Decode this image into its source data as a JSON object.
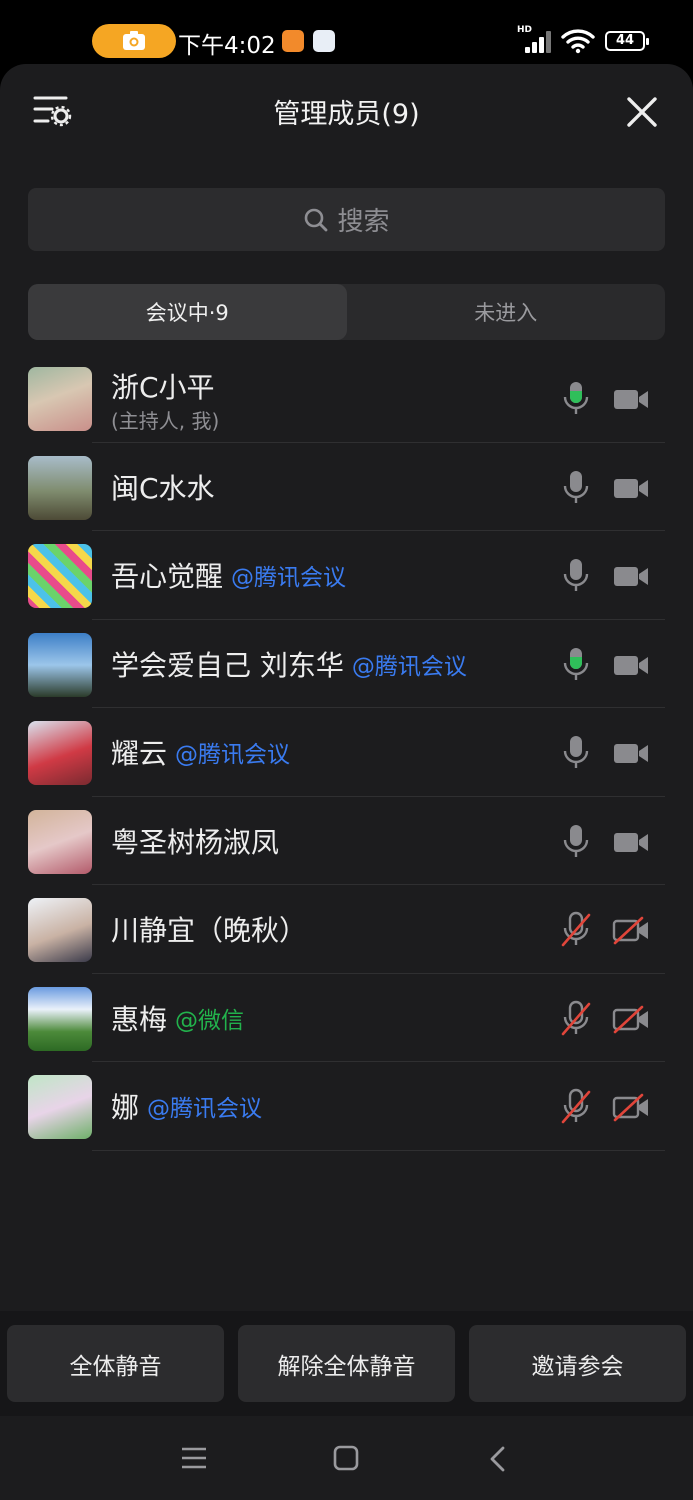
{
  "status_bar": {
    "time": "下午4:02",
    "battery": "44",
    "network": "HD"
  },
  "header": {
    "title": "管理成员(9)"
  },
  "search": {
    "placeholder": "搜索"
  },
  "tabs": [
    {
      "label": "会议中·9"
    },
    {
      "label": "未进入"
    }
  ],
  "participants": [
    {
      "name": "浙C小平",
      "subtitle": "(主持人, 我)",
      "tag": "",
      "mic": "active",
      "camera": "off"
    },
    {
      "name": "闽C水水",
      "subtitle": "",
      "tag": "",
      "mic": "idle",
      "camera": "idle"
    },
    {
      "name": "吾心觉醒",
      "subtitle": "",
      "tag": "@腾讯会议",
      "mic": "idle",
      "camera": "idle"
    },
    {
      "name": "学会爱自己 刘东华",
      "subtitle": "",
      "tag": "@腾讯会议",
      "mic": "active",
      "camera": "idle"
    },
    {
      "name": "耀云",
      "subtitle": "",
      "tag": "@腾讯会议",
      "mic": "idle",
      "camera": "idle"
    },
    {
      "name": "粤圣树杨淑凤",
      "subtitle": "",
      "tag": "",
      "mic": "idle",
      "camera": "idle"
    },
    {
      "name": "川静宜（晚秋）",
      "subtitle": "",
      "tag": "",
      "mic": "muted",
      "camera": "muted"
    },
    {
      "name": "惠梅",
      "subtitle": "",
      "tag": "@微信",
      "mic": "muted",
      "camera": "muted"
    },
    {
      "name": "娜",
      "subtitle": "",
      "tag": "@腾讯会议",
      "mic": "muted",
      "camera": "muted"
    }
  ],
  "actions": {
    "mute_all": "全体静音",
    "unmute_all": "解除全体静音",
    "invite": "邀请参会"
  },
  "colors": {
    "accent_blue": "#3a7bf0",
    "wechat_green": "#22b24c",
    "mic_active": "#2fbf5a",
    "muted_red": "#e0453a"
  }
}
